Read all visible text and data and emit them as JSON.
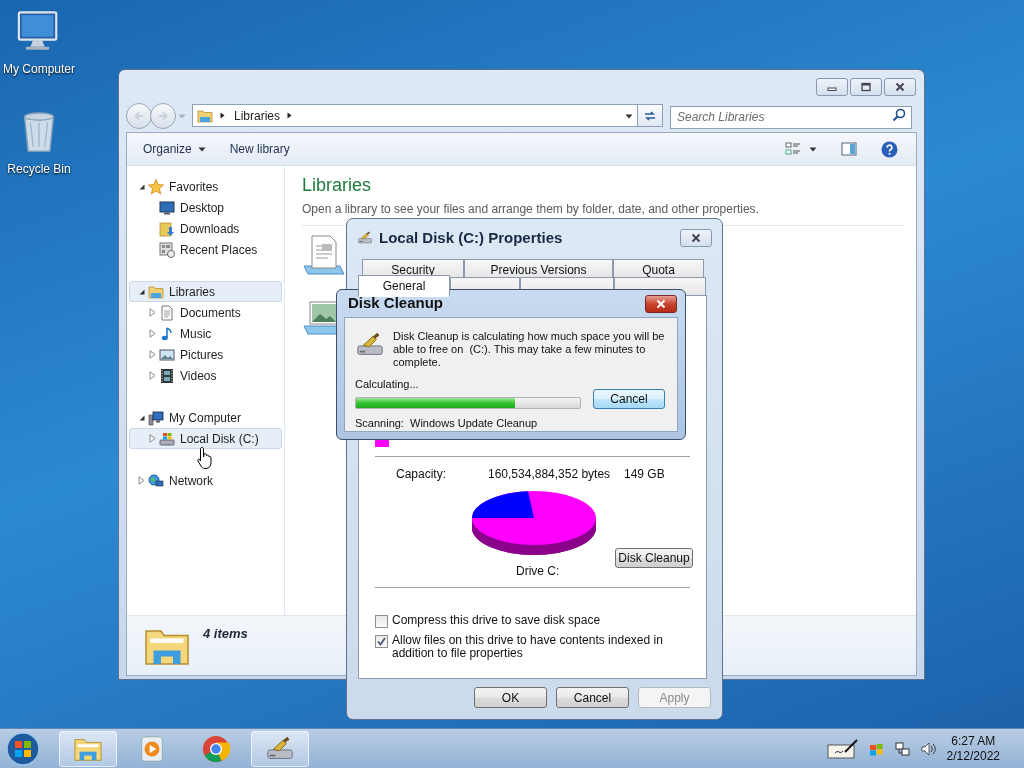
{
  "desktop_icons": [
    {
      "label": "My Computer",
      "kind": "computer"
    },
    {
      "label": "Recycle Bin",
      "kind": "bin"
    }
  ],
  "explorer": {
    "address": "Libraries",
    "search": {
      "placeholder": "Search Libraries"
    },
    "toolbar": [
      {
        "label": "Organize",
        "menu": true
      },
      {
        "label": "New library",
        "menu": false
      }
    ],
    "nav": [
      {
        "label": "Favorites",
        "kind": "star",
        "expanded": true,
        "highlighted": false,
        "children": [
          {
            "label": "Desktop",
            "kind": "desktop",
            "highlighted": false
          },
          {
            "label": "Downloads",
            "kind": "downloads",
            "highlighted": false
          },
          {
            "label": "Recent Places",
            "kind": "recent",
            "highlighted": false
          }
        ]
      },
      {
        "label": "Libraries",
        "kind": "library",
        "expanded": true,
        "highlighted": true,
        "children": [
          {
            "label": "Documents",
            "kind": "documents",
            "expanded": false,
            "highlighted": false
          },
          {
            "label": "Music",
            "kind": "music",
            "expanded": false,
            "highlighted": false
          },
          {
            "label": "Pictures",
            "kind": "pictures",
            "expanded": false,
            "highlighted": false
          },
          {
            "label": "Videos",
            "kind": "videos",
            "expanded": false,
            "highlighted": false
          }
        ]
      },
      {
        "label": "My Computer",
        "kind": "computer",
        "expanded": true,
        "highlighted": false,
        "children": [
          {
            "label": "Local Disk (C:)",
            "kind": "disk",
            "expanded": false,
            "highlighted": true
          }
        ]
      },
      {
        "label": "Network",
        "kind": "network",
        "expanded": false,
        "highlighted": false
      }
    ],
    "heading": "Libraries",
    "description": "Open a library to see your files and arrange them by folder, date, and other properties.",
    "library_tiles": [
      {
        "kind": "documents"
      },
      {
        "kind": "pictures"
      }
    ],
    "details": {
      "count": "4 items"
    }
  },
  "properties": {
    "title": "Local Disk (C:) Properties",
    "tabs_back": [
      {
        "label": "Security",
        "selected": false
      },
      {
        "label": "Previous Versions",
        "selected": false
      },
      {
        "label": "Quota",
        "selected": false
      }
    ],
    "tabs_front": [
      {
        "label": "General",
        "selected": true
      },
      {
        "selected": false
      },
      {
        "selected": false
      },
      {
        "selected": false
      }
    ],
    "used_swatch": {
      "color": "#ff00ff"
    },
    "capacity": {
      "label": "Capacity:",
      "bytes": "160,534,884,352 bytes",
      "size": "149 GB"
    },
    "drive_label": "Drive C:",
    "cleanup_button": "Disk Cleanup",
    "options": [
      {
        "label": "Compress this drive to save disk space",
        "checked": false
      },
      {
        "label": "Allow files on this drive to have contents indexed in addition to file properties",
        "checked": true
      }
    ],
    "buttons": [
      {
        "label": "OK",
        "disabled": false
      },
      {
        "label": "Cancel",
        "disabled": false
      },
      {
        "label": "Apply",
        "disabled": true
      }
    ]
  },
  "disk_cleanup": {
    "title": "Disk Cleanup",
    "message": "Disk Cleanup is calculating how much space you will be able to free on  (C:). This may take a few minutes to complete.",
    "status": "Calculating...",
    "progress": {
      "level": 0.71
    },
    "cancel": "Cancel",
    "scanning": "Scanning:  Windows Update Cleanup"
  },
  "taskbar": {
    "items": [
      {
        "kind": "explorer",
        "active": true
      },
      {
        "kind": "media",
        "active": false
      },
      {
        "kind": "browser",
        "active": false
      },
      {
        "kind": "cleanup",
        "active": true
      }
    ],
    "tray": [
      {
        "kind": "pen"
      },
      {
        "kind": "flag"
      },
      {
        "kind": "network"
      },
      {
        "kind": "volume"
      }
    ],
    "clock": {
      "time": "6:27 AM",
      "date": "2/12/2022"
    }
  }
}
